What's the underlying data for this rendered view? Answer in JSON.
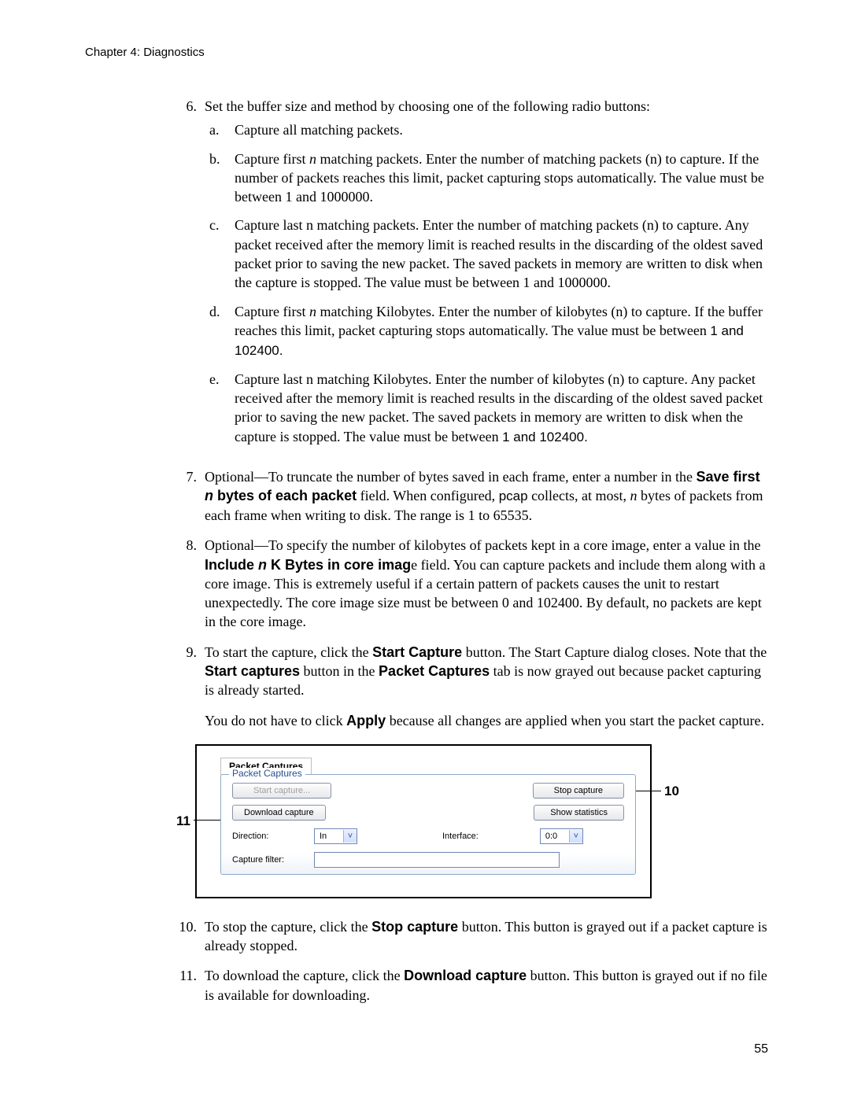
{
  "header": {
    "text": "Chapter 4:   Diagnostics"
  },
  "list": {
    "item6": {
      "num": "6.",
      "intro": "Set the buffer size and method by choosing one of the following radio buttons:",
      "a": {
        "letter": "a.",
        "text": "Capture all matching packets."
      },
      "b": {
        "letter": "b.",
        "pre": "Capture first ",
        "n": "n",
        "post": " matching packets. Enter the number of matching packets (n) to capture. If the number of packets reaches this limit, packet capturing stops automatically. The value must be between 1 and 1000000."
      },
      "c": {
        "letter": "c.",
        "text": "Capture last n matching packets. Enter the number of matching packets (n) to capture. Any packet received after the memory limit is reached results in the discarding of the oldest saved packet prior to saving the new packet. The saved packets in memory are written to disk when the capture is stopped. The value must be between 1 and 1000000."
      },
      "d": {
        "letter": "d.",
        "pre": "Capture first ",
        "n": "n",
        "mid": " matching Kilobytes. Enter the number of kilobytes (n) to capture. If the buffer reaches this limit, packet capturing stops automatically. The value must be between ",
        "range": "1 and 102400."
      },
      "e": {
        "letter": "e.",
        "pre": "Capture last n matching Kilobytes. Enter the number of kilobytes (n) to capture. Any packet received after the memory limit is reached results in the discarding of the oldest saved packet prior to saving the new packet. The saved packets in memory are written to disk when the capture is stopped. The value must be between ",
        "range": "1 and 102400."
      }
    },
    "item7": {
      "num": "7.",
      "seg1": "Optional—To truncate the number of bytes saved in each frame, enter a number in the ",
      "bold_pre": "Save first ",
      "bold_n": "n",
      "bold_post": " bytes of each packet",
      "seg2": " field. When configured, ",
      "pcap": "pcap",
      "seg3": " collects, at most, ",
      "n2": "n",
      "seg4": " bytes of packets from each frame when writing to disk. The range is 1 to 65535."
    },
    "item8": {
      "num": "8.",
      "seg1": "Optional—To specify the number of kilobytes of packets kept in a core image, enter a value in the ",
      "bold_pre": "Include ",
      "bold_n": "n",
      "bold_post": " K Bytes in core imag",
      "seg2": "e field. You can capture packets and include them along with a core image. This is extremely useful if a certain pattern of packets causes the unit to restart unexpectedly. The core image size must be between 0 and 102400. By default, no packets are kept in the core image."
    },
    "item9": {
      "num": "9.",
      "seg1": "To start the capture, click the ",
      "b1": "Start Capture",
      "seg2": " button. The Start Capture dialog closes. Note that the ",
      "b2": "Start captures",
      "seg3": " button in the ",
      "b3": "Packet Captures",
      "seg4": " tab is now grayed out because packet capturing is already started."
    },
    "apply_para": {
      "pre": "You do not have to click ",
      "b": "Apply",
      "post": " because all changes are applied when you start the packet capture."
    },
    "item10": {
      "num": "10.",
      "seg1": "To stop the capture, click the ",
      "b1": "Stop capture",
      "seg2": " button. This button is grayed out if a packet capture is already stopped."
    },
    "item11": {
      "num": "11.",
      "seg1": "To download the capture, click the ",
      "b1": "Download capture",
      "seg2": " button. This button is grayed out if no file is available for downloading."
    }
  },
  "panel": {
    "tab": "Packet Captures",
    "legend": "Packet Captures",
    "buttons": {
      "start": "Start capture...",
      "stop": "Stop capture",
      "download": "Download capture",
      "stats": "Show statistics"
    },
    "fields": {
      "direction_label": "Direction:",
      "direction_value": "In",
      "interface_label": "Interface:",
      "interface_value": "0:0",
      "filter_label": "Capture filter:"
    }
  },
  "callouts": {
    "c10": "10",
    "c11": "11"
  },
  "page_number": "55"
}
